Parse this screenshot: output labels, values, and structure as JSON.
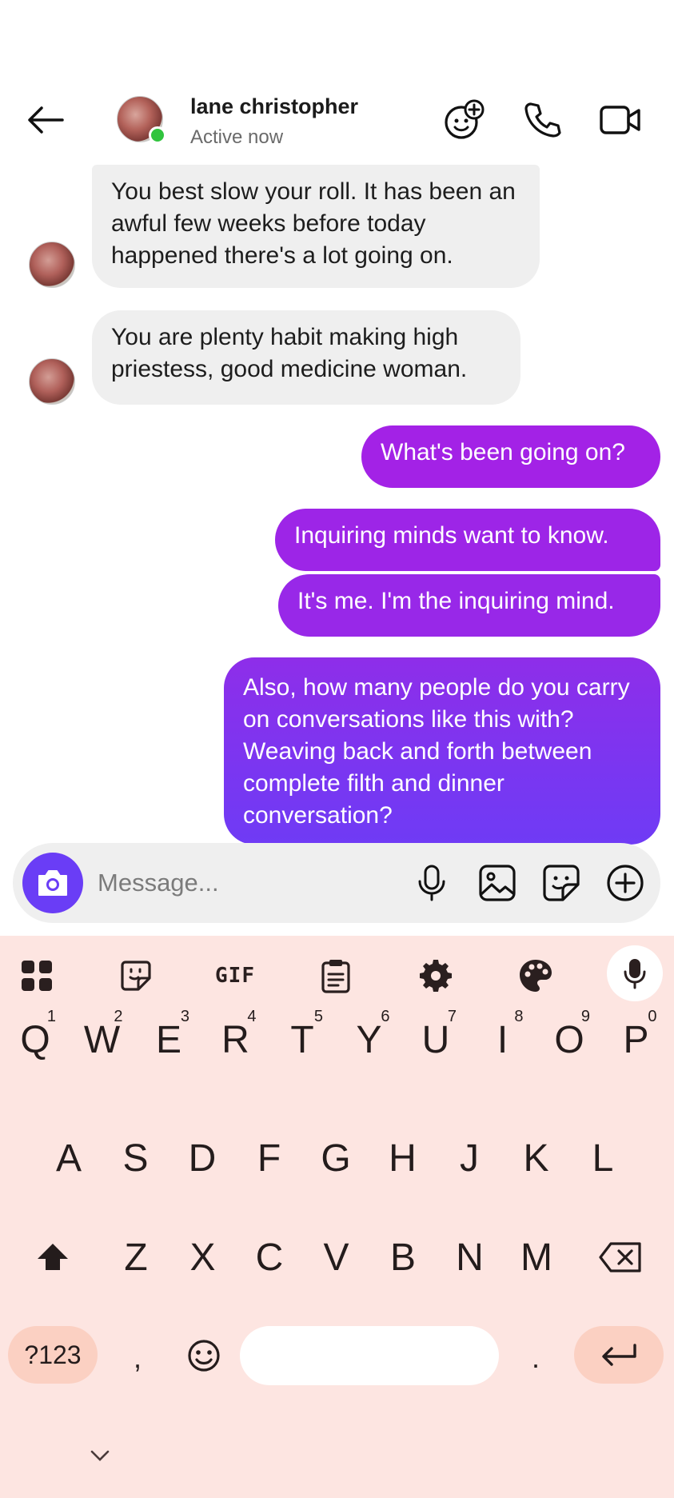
{
  "header": {
    "name": "lane christopher",
    "status": "Active now"
  },
  "messages": [
    {
      "from": "them",
      "text": "You best slow your roll. It has been an awful few weeks before today happened  there's a lot going on."
    },
    {
      "from": "them",
      "text": "You are plenty habit making high priestess, good medicine woman."
    },
    {
      "from": "me",
      "text": "What's been going on?"
    },
    {
      "from": "me",
      "text": "Inquiring minds want to know."
    },
    {
      "from": "me",
      "text": "It's me. I'm the inquiring mind."
    },
    {
      "from": "me",
      "text": "Also, how many people do you carry on conversations like this with? Weaving back and forth between complete filth and dinner conversation?"
    }
  ],
  "composer": {
    "placeholder": "Message..."
  },
  "keyboard": {
    "toolbar": {
      "gif_label": "GIF"
    },
    "row1": [
      {
        "key": "Q",
        "num": "1"
      },
      {
        "key": "W",
        "num": "2"
      },
      {
        "key": "E",
        "num": "3"
      },
      {
        "key": "R",
        "num": "4"
      },
      {
        "key": "T",
        "num": "5"
      },
      {
        "key": "Y",
        "num": "6"
      },
      {
        "key": "U",
        "num": "7"
      },
      {
        "key": "I",
        "num": "8"
      },
      {
        "key": "O",
        "num": "9"
      },
      {
        "key": "P",
        "num": "0"
      }
    ],
    "row2": [
      "A",
      "S",
      "D",
      "F",
      "G",
      "H",
      "J",
      "K",
      "L"
    ],
    "row3": [
      "Z",
      "X",
      "C",
      "V",
      "B",
      "N",
      "M"
    ],
    "symbols_label": "?123",
    "comma": ",",
    "period": "."
  },
  "colors": {
    "accent": "#6a3df6",
    "bubble_out_top": "#a123e6",
    "bubble_out_bottom": "#6f3bf5",
    "online": "#31c43e",
    "keyboard_bg": "#fde5e1"
  }
}
